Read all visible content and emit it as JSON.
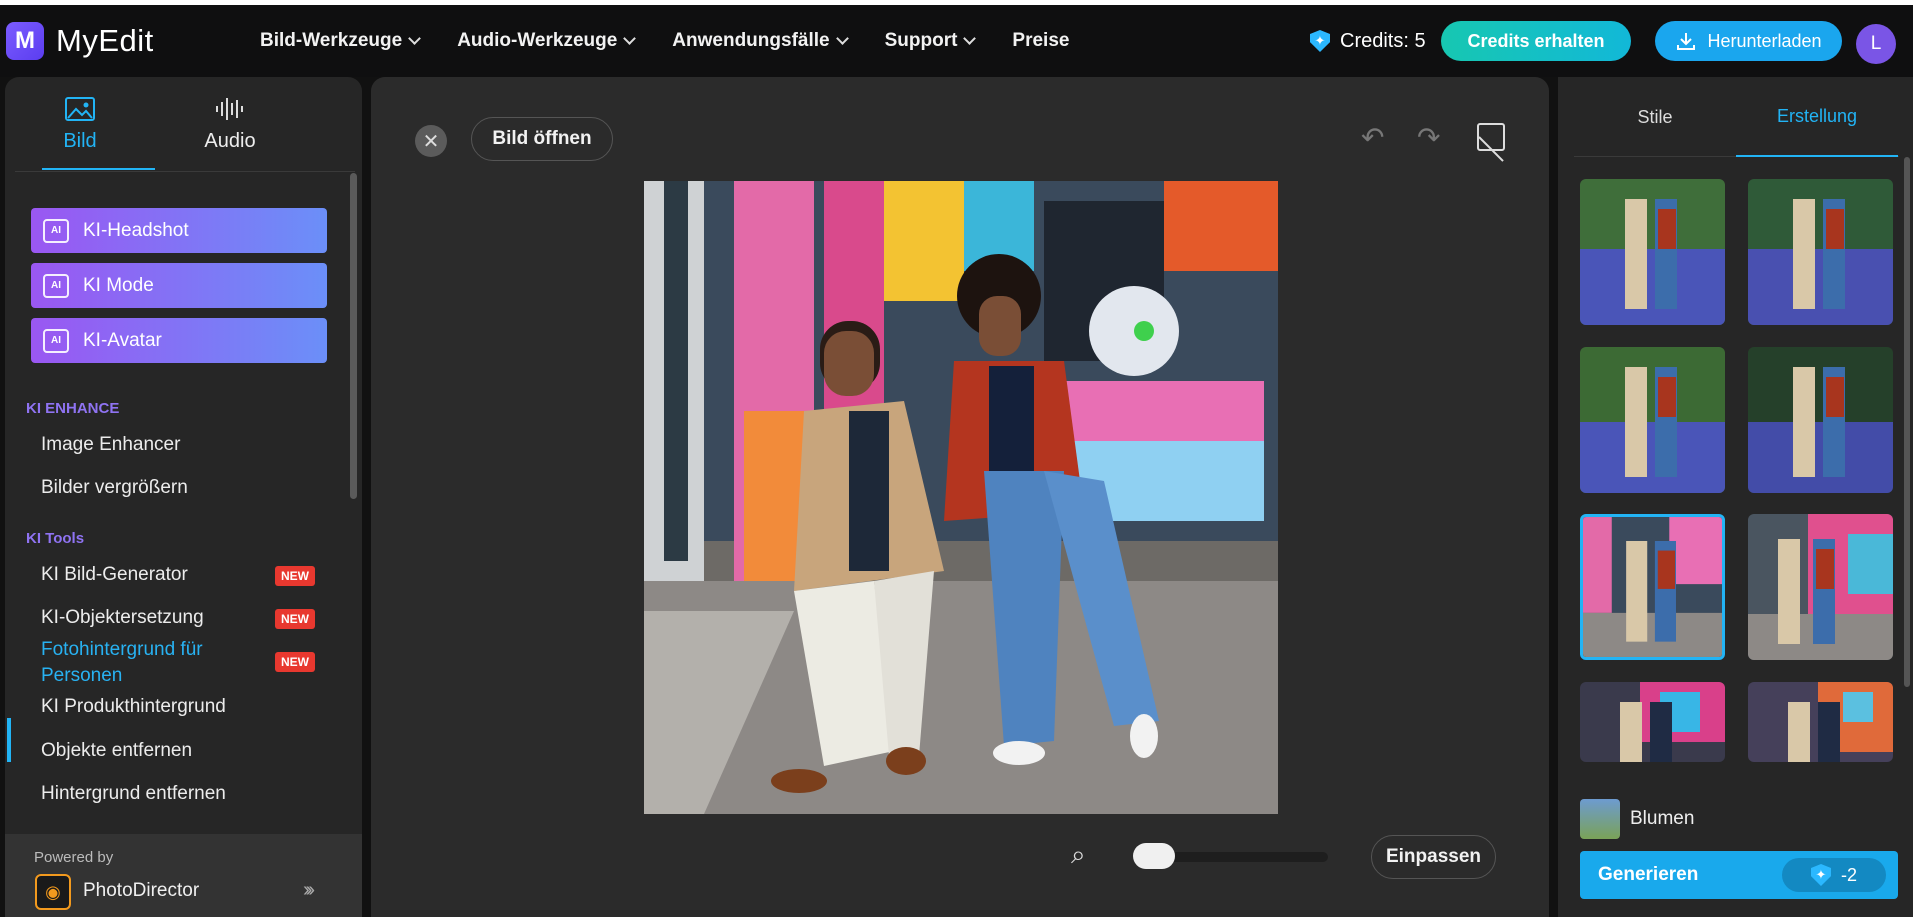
{
  "app": {
    "logo_letter": "M",
    "name": "MyEdit"
  },
  "nav": [
    {
      "label": "Bild-Werkzeuge"
    },
    {
      "label": "Audio-Werkzeuge"
    },
    {
      "label": "Anwendungsfälle"
    },
    {
      "label": "Support"
    },
    {
      "label": "Preise"
    }
  ],
  "header": {
    "credits_label": "Credits: 5",
    "credits_button": "Credits erhalten",
    "download_button": "Herunterladen",
    "avatar_initial": "L"
  },
  "sidebar": {
    "tabs": [
      {
        "label": "Bild"
      },
      {
        "label": "Audio"
      }
    ],
    "ai_buttons": [
      {
        "label": "KI-Headshot"
      },
      {
        "label": "KI Mode"
      },
      {
        "label": "KI-Avatar"
      }
    ],
    "section_enhance": "KI ENHANCE",
    "enhance_items": [
      {
        "label": "Image Enhancer"
      },
      {
        "label": "Bilder vergrößern"
      }
    ],
    "section_tools": "KI Tools",
    "tool_items": [
      {
        "label": "KI Bild-Generator",
        "badge": "NEW"
      },
      {
        "label": "KI-Objektersetzung",
        "badge": "NEW"
      },
      {
        "label": "Fotohintergrund für Personen",
        "badge": "NEW"
      },
      {
        "label": "KI Produkthintergrund"
      },
      {
        "label": "Objekte entfernen"
      },
      {
        "label": "Hintergrund entfernen"
      }
    ],
    "powered_by": "Powered by",
    "powered_product": "PhotoDirector"
  },
  "canvas": {
    "open_button": "Bild öffnen",
    "fit_button": "Einpassen",
    "zoom_level": 0.05
  },
  "right": {
    "tabs": [
      {
        "label": "Stile"
      },
      {
        "label": "Erstellung"
      }
    ],
    "selected_style": "Blumen",
    "generate_button": "Generieren",
    "generate_cost": "-2"
  },
  "colors": {
    "accent": "#22b4f5",
    "purple": "#8f73f2",
    "new_badge": "#e8382f"
  }
}
